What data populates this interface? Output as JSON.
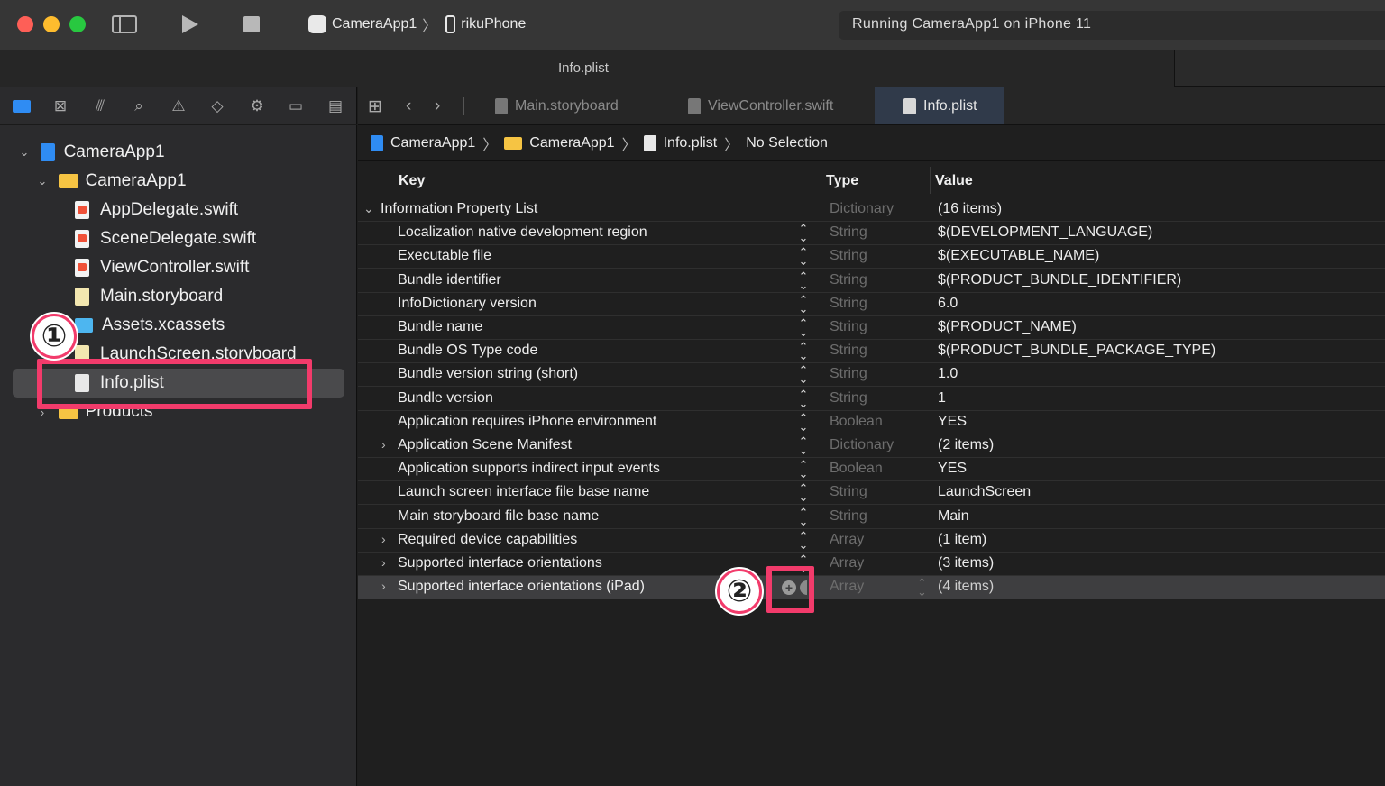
{
  "window": {
    "scheme_app": "CameraApp1",
    "scheme_device": "rikuPhone",
    "status": "Running CameraApp1 on iPhone 11",
    "file_title": "Info.plist"
  },
  "navigator": {
    "items": [
      {
        "label": "CameraApp1",
        "kind": "project"
      },
      {
        "label": "CameraApp1",
        "kind": "folder"
      },
      {
        "label": "AppDelegate.swift",
        "kind": "swift"
      },
      {
        "label": "SceneDelegate.swift",
        "kind": "swift"
      },
      {
        "label": "ViewController.swift",
        "kind": "swift"
      },
      {
        "label": "Main.storyboard",
        "kind": "storyboard"
      },
      {
        "label": "Assets.xcassets",
        "kind": "assets"
      },
      {
        "label": "LaunchScreen.storyboard",
        "kind": "storyboard"
      },
      {
        "label": "Info.plist",
        "kind": "plist",
        "selected": true
      },
      {
        "label": "Products",
        "kind": "folder"
      }
    ]
  },
  "tabs": [
    {
      "label": "Main.storyboard"
    },
    {
      "label": "ViewController.swift"
    },
    {
      "label": "Info.plist",
      "active": true
    }
  ],
  "jumpbar": {
    "project": "CameraApp1",
    "folder": "CameraApp1",
    "file": "Info.plist",
    "selection": "No Selection"
  },
  "plist": {
    "headers": {
      "key": "Key",
      "type": "Type",
      "value": "Value"
    },
    "rows": [
      {
        "key": "Information Property List",
        "type": "Dictionary",
        "value": "(16 items)"
      },
      {
        "key": "Localization native development region",
        "type": "String",
        "value": "$(DEVELOPMENT_LANGUAGE)"
      },
      {
        "key": "Executable file",
        "type": "String",
        "value": "$(EXECUTABLE_NAME)"
      },
      {
        "key": "Bundle identifier",
        "type": "String",
        "value": "$(PRODUCT_BUNDLE_IDENTIFIER)"
      },
      {
        "key": "InfoDictionary version",
        "type": "String",
        "value": "6.0"
      },
      {
        "key": "Bundle name",
        "type": "String",
        "value": "$(PRODUCT_NAME)"
      },
      {
        "key": "Bundle OS Type code",
        "type": "String",
        "value": "$(PRODUCT_BUNDLE_PACKAGE_TYPE)"
      },
      {
        "key": "Bundle version string (short)",
        "type": "String",
        "value": "1.0"
      },
      {
        "key": "Bundle version",
        "type": "String",
        "value": "1"
      },
      {
        "key": "Application requires iPhone environment",
        "type": "Boolean",
        "value": "YES"
      },
      {
        "key": "Application Scene Manifest",
        "type": "Dictionary",
        "value": "(2 items)"
      },
      {
        "key": "Application supports indirect input events",
        "type": "Boolean",
        "value": "YES"
      },
      {
        "key": "Launch screen interface file base name",
        "type": "String",
        "value": "LaunchScreen"
      },
      {
        "key": "Main storyboard file base name",
        "type": "String",
        "value": "Main"
      },
      {
        "key": "Required device capabilities",
        "type": "Array",
        "value": "(1 item)"
      },
      {
        "key": "Supported interface orientations",
        "type": "Array",
        "value": "(3 items)"
      },
      {
        "key": "Supported interface orientations (iPad)",
        "type": "Array",
        "value": "(4 items)"
      }
    ]
  },
  "annotations": {
    "badge1": "①",
    "badge2": "②"
  },
  "colors": {
    "accent": "#2f8cf3",
    "annotation": "#f23b6b",
    "folder": "#f6c443"
  }
}
